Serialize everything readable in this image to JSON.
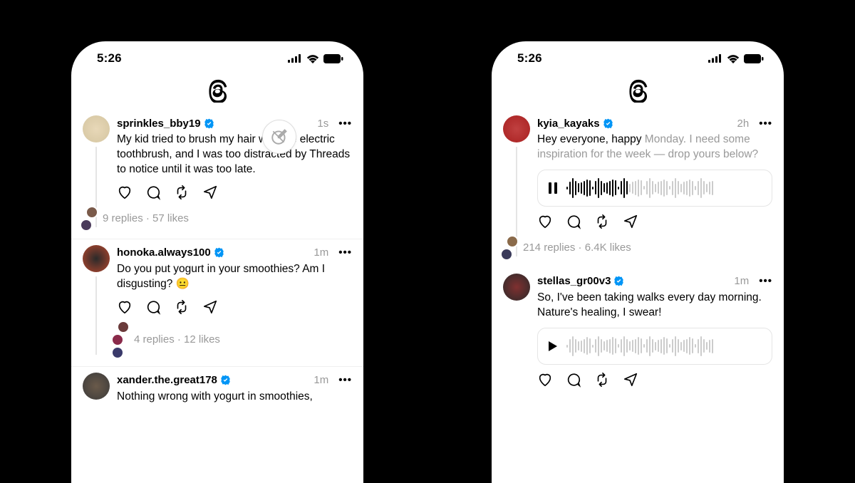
{
  "status_time": "5:26",
  "phone_left": {
    "posts": [
      {
        "username": "sprinkles_bby19",
        "timestamp": "1s",
        "text": "My kid tried to brush my hair with the electric toothbrush, and I was too distracted by Threads to notice until it was too late.",
        "replies": "9 replies",
        "likes": "57 likes",
        "avatar_colors": [
          "#d4c5a0",
          "#e8d8b8"
        ]
      },
      {
        "username": "honoka.always100",
        "timestamp": "1m",
        "text": "Do you put yogurt in your smoothies? Am I disgusting? 😐",
        "replies": "4 replies",
        "likes": "12 likes",
        "avatar_colors": [
          "#b5472e",
          "#2a2a2a"
        ]
      },
      {
        "username": "xander.the.great178",
        "timestamp": "1m",
        "text": "Nothing wrong with yogurt in smoothies,",
        "avatar_colors": [
          "#3a3a3a",
          "#6a5a4a"
        ]
      }
    ]
  },
  "phone_right": {
    "posts": [
      {
        "username": "kyia_kayaks",
        "timestamp": "2h",
        "text_pre": "Hey everyone, happy ",
        "text_faded": "Monday. I need some inspiration for the week — drop yours below?",
        "replies": "214 replies",
        "likes": "6.4K likes",
        "voice_state": "pause",
        "avatar_colors": [
          "#a82020",
          "#c04040"
        ]
      },
      {
        "username": "stellas_gr00v3",
        "timestamp": "1m",
        "text": "So, I've been taking walks every day morning. Nature's healing, I swear!",
        "voice_state": "play",
        "avatar_colors": [
          "#2a2a2a",
          "#803030"
        ]
      }
    ]
  },
  "sep": " · "
}
